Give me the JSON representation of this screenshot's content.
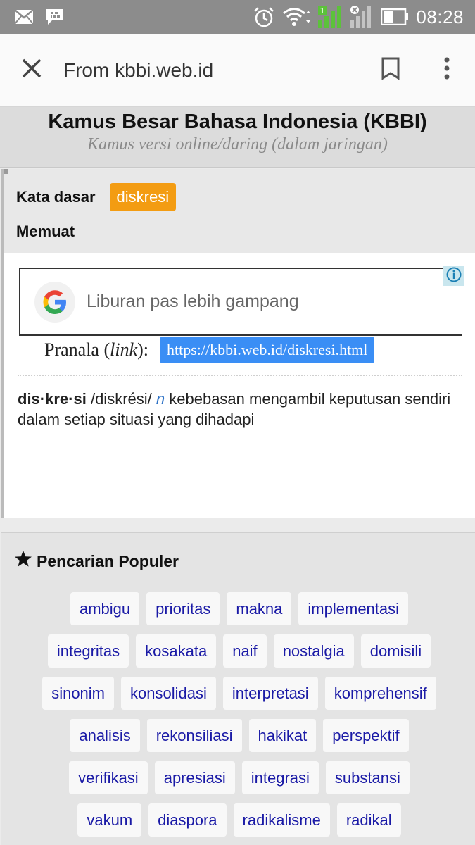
{
  "status_bar": {
    "time": "08:28",
    "icons": [
      "mail-icon",
      "bbm-icon",
      "alarm-icon",
      "wifi-icon",
      "signal-icon",
      "signal-no-service-icon",
      "battery-icon"
    ]
  },
  "toolbar": {
    "title": "From kbbi.web.id",
    "icons": [
      "close-icon",
      "bookmark-icon",
      "overflow-menu-icon"
    ]
  },
  "header": {
    "title": "Kamus Besar Bahasa Indonesia (KBBI)",
    "subtitle": "Kamus versi online/daring (dalam jaringan)"
  },
  "entry": {
    "kata_dasar_label": "Kata dasar",
    "kata_dasar_value": "diskresi",
    "memuat_label": "Memuat"
  },
  "ad": {
    "text": "Liburan pas lebih gampang"
  },
  "pranala": {
    "label_prefix": "Pranala (",
    "label_italic": "link",
    "label_suffix": "):",
    "url": "https://kbbi.web.id/diskresi.html"
  },
  "definition": {
    "headword": "dis·kre·si",
    "pronunciation": "/diskrési/",
    "pos": "n",
    "meaning": "kebebasan mengambil keputusan sendiri dalam setiap situasi yang dihadapi"
  },
  "popular": {
    "title": "Pencarian Populer",
    "rows": [
      [
        "ambigu",
        "prioritas",
        "makna",
        "implementasi"
      ],
      [
        "integritas",
        "kosakata",
        "naif",
        "nostalgia",
        "domisili"
      ],
      [
        "sinonim",
        "konsolidasi",
        "interpretasi",
        "komprehensif"
      ],
      [
        "analisis",
        "rekonsiliasi",
        "hakikat",
        "perspektif"
      ],
      [
        "verifikasi",
        "apresiasi",
        "integrasi",
        "substansi"
      ],
      [
        "vakum",
        "diaspora",
        "radikalisme",
        "radikal"
      ]
    ]
  },
  "colors": {
    "badge": "#f39c12",
    "link_pill": "#3a8ef5",
    "tag_text": "#1a1aa6",
    "status_bar": "#8c8c8c"
  }
}
